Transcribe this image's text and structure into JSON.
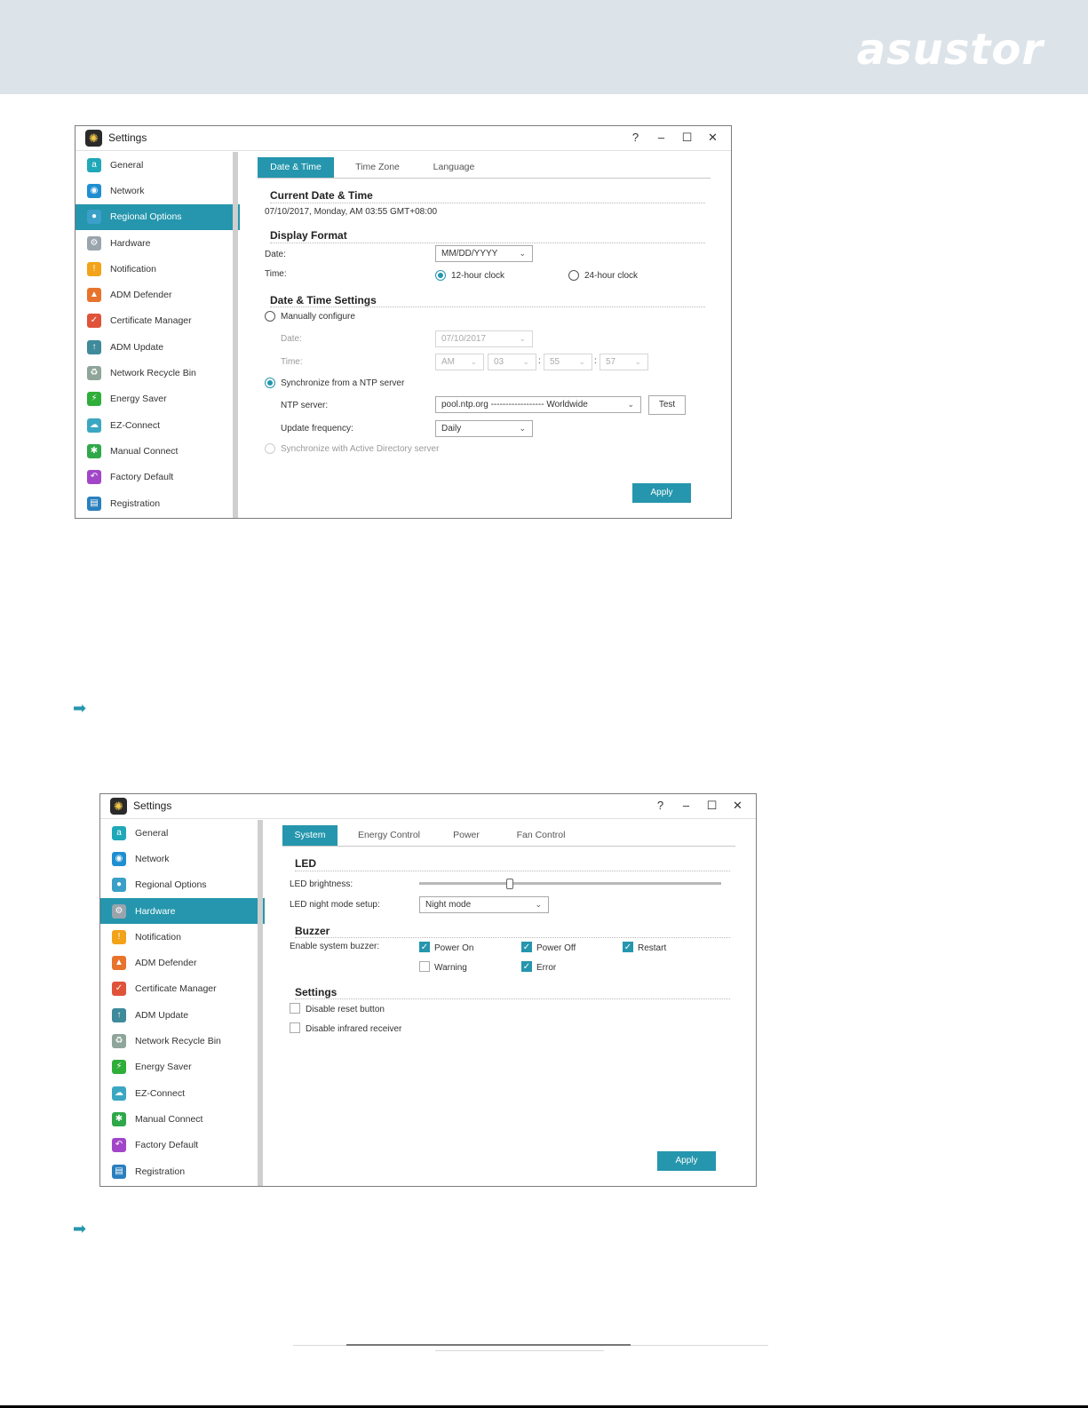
{
  "brand": {
    "logo_text": "asustor",
    "logo_color": "#ffffff",
    "banner_color": "#dde4e9"
  },
  "accent_color": "#2596ad",
  "nav_icons": [
    {
      "name": "general-icon",
      "glyph": "a",
      "color": "#1fa8b8"
    },
    {
      "name": "network-icon",
      "glyph": "◉",
      "color": "#1f8fd1"
    },
    {
      "name": "regional-options-icon",
      "glyph": "●",
      "color": "#3aa0c8"
    },
    {
      "name": "hardware-icon",
      "glyph": "⚙",
      "color": "#9aa4ad"
    },
    {
      "name": "notification-icon",
      "glyph": "!",
      "color": "#f2a31a"
    },
    {
      "name": "adm-defender-icon",
      "glyph": "▲",
      "color": "#e8732c"
    },
    {
      "name": "certificate-manager-icon",
      "glyph": "✓",
      "color": "#e0533a"
    },
    {
      "name": "adm-update-icon",
      "glyph": "↑",
      "color": "#3f8a9b"
    },
    {
      "name": "network-recycle-bin-icon",
      "glyph": "♻",
      "color": "#8fa59a"
    },
    {
      "name": "energy-saver-icon",
      "glyph": "⚡",
      "color": "#2fae3a"
    },
    {
      "name": "ez-connect-icon",
      "glyph": "☁",
      "color": "#3ba7c2"
    },
    {
      "name": "manual-connect-icon",
      "glyph": "✱",
      "color": "#2fa84a"
    },
    {
      "name": "factory-default-icon",
      "glyph": "↶",
      "color": "#a246c9"
    },
    {
      "name": "registration-icon",
      "glyph": "▤",
      "color": "#2a7fbf"
    }
  ],
  "window1": {
    "title": "Settings",
    "controls": {
      "help": "?",
      "minimize": "–",
      "maximize": "☐",
      "close": "✕"
    },
    "sidebar": [
      "General",
      "Network",
      "Regional Options",
      "Hardware",
      "Notification",
      "ADM Defender",
      "Certificate Manager",
      "ADM Update",
      "Network Recycle Bin",
      "Energy Saver",
      "EZ-Connect",
      "Manual Connect",
      "Factory Default",
      "Registration"
    ],
    "active_item": "Regional Options",
    "tabs": [
      "Date & Time",
      "Time Zone",
      "Language"
    ],
    "current_section": "Current Date & Time",
    "current_value": "07/10/2017, Monday, AM 03:55 GMT+08:00",
    "display_section": "Display Format",
    "date_label": "Date:",
    "date_format": "MM/DD/YYYY",
    "time_label": "Time:",
    "clock_12": "12-hour clock",
    "clock_24": "24-hour clock",
    "settings_section": "Date & Time Settings",
    "manual": "Manually configure",
    "manual_date_label": "Date:",
    "manual_date": "07/10/2017",
    "manual_time_label": "Time:",
    "ampm": "AM",
    "hour": "03",
    "minute": "55",
    "second": "57",
    "colon": ":",
    "ntp_option": "Synchronize from a NTP server",
    "ntp_label": "NTP server:",
    "ntp_value": "pool.ntp.org ------------------ Worldwide",
    "test": "Test",
    "freq_label": "Update frequency:",
    "freq_value": "Daily",
    "ad_option": "Synchronize with Active Directory server",
    "apply": "Apply"
  },
  "window2": {
    "title": "Settings",
    "controls": {
      "help": "?",
      "minimize": "–",
      "maximize": "☐",
      "close": "✕"
    },
    "sidebar": [
      "General",
      "Network",
      "Regional Options",
      "Hardware",
      "Notification",
      "ADM Defender",
      "Certificate Manager",
      "ADM Update",
      "Network Recycle Bin",
      "Energy Saver",
      "EZ-Connect",
      "Manual Connect",
      "Factory Default",
      "Registration"
    ],
    "active_item": "Hardware",
    "tabs": [
      "System",
      "Energy Control",
      "Power",
      "Fan Control"
    ],
    "led_section": "LED",
    "brightness_label": "LED brightness:",
    "brightness_level": 0.3,
    "night_label": "LED night mode setup:",
    "night_value": "Night mode",
    "buzzer_section": "Buzzer",
    "buzzer_label": "Enable system buzzer:",
    "buzzer_options": [
      {
        "label": "Power On",
        "checked": true
      },
      {
        "label": "Power Off",
        "checked": true
      },
      {
        "label": "Restart",
        "checked": true
      },
      {
        "label": "Warning",
        "checked": false
      },
      {
        "label": "Error",
        "checked": true
      }
    ],
    "settings_section": "Settings",
    "disable_reset": "Disable reset button",
    "disable_ir": "Disable infrared receiver",
    "apply": "Apply"
  },
  "arrow_glyph": "➡"
}
